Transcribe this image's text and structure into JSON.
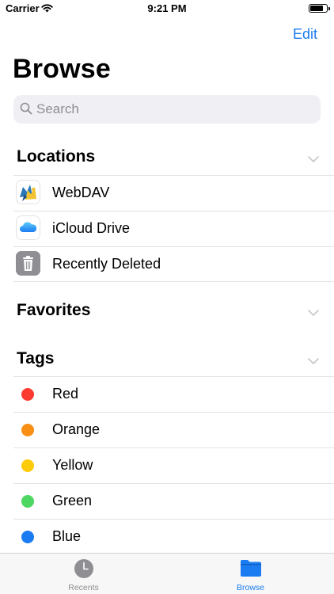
{
  "status_bar": {
    "carrier": "Carrier",
    "time": "9:21 PM",
    "battery_level": 0.8
  },
  "nav": {
    "edit_label": "Edit",
    "title": "Browse"
  },
  "search": {
    "placeholder": "Search"
  },
  "sections": {
    "locations": {
      "title": "Locations",
      "items": [
        {
          "label": "WebDAV",
          "icon": "webdav-icon"
        },
        {
          "label": "iCloud Drive",
          "icon": "icloud-drive-icon"
        },
        {
          "label": "Recently Deleted",
          "icon": "trash-icon"
        }
      ]
    },
    "favorites": {
      "title": "Favorites"
    },
    "tags": {
      "title": "Tags",
      "items": [
        {
          "label": "Red",
          "color": "#fb3b30"
        },
        {
          "label": "Orange",
          "color": "#f98f14"
        },
        {
          "label": "Yellow",
          "color": "#fccb0a"
        },
        {
          "label": "Green",
          "color": "#4cd662"
        },
        {
          "label": "Blue",
          "color": "#1b7cf2"
        }
      ]
    }
  },
  "tab_bar": {
    "tabs": [
      {
        "label": "Recents",
        "icon": "clock-icon",
        "selected": false
      },
      {
        "label": "Browse",
        "icon": "folder-icon",
        "selected": true
      }
    ]
  },
  "colors": {
    "accent": "#1a7cf0",
    "inactive": "#8e8e93"
  }
}
